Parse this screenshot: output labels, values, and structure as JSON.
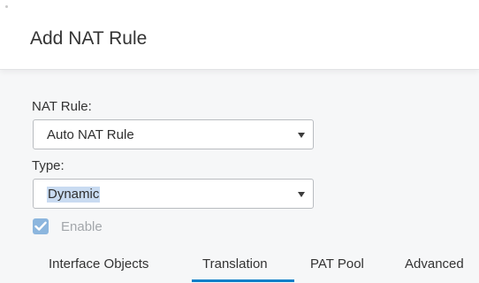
{
  "dialog": {
    "title": "Add NAT Rule"
  },
  "nat_rule": {
    "label": "NAT Rule:",
    "value": "Auto NAT Rule"
  },
  "type": {
    "label": "Type:",
    "value": "Dynamic"
  },
  "enable": {
    "label": "Enable",
    "checked": true
  },
  "tabs": [
    {
      "label": "Interface Objects"
    },
    {
      "label": "Translation",
      "active": true
    },
    {
      "label": "PAT Pool"
    },
    {
      "label": "Advanced"
    }
  ],
  "colors": {
    "accent": "#0d7fc8",
    "checkbox": "#8cb6de",
    "selection_highlight": "#c9dbf1",
    "body_background": "#f6f7f8"
  }
}
